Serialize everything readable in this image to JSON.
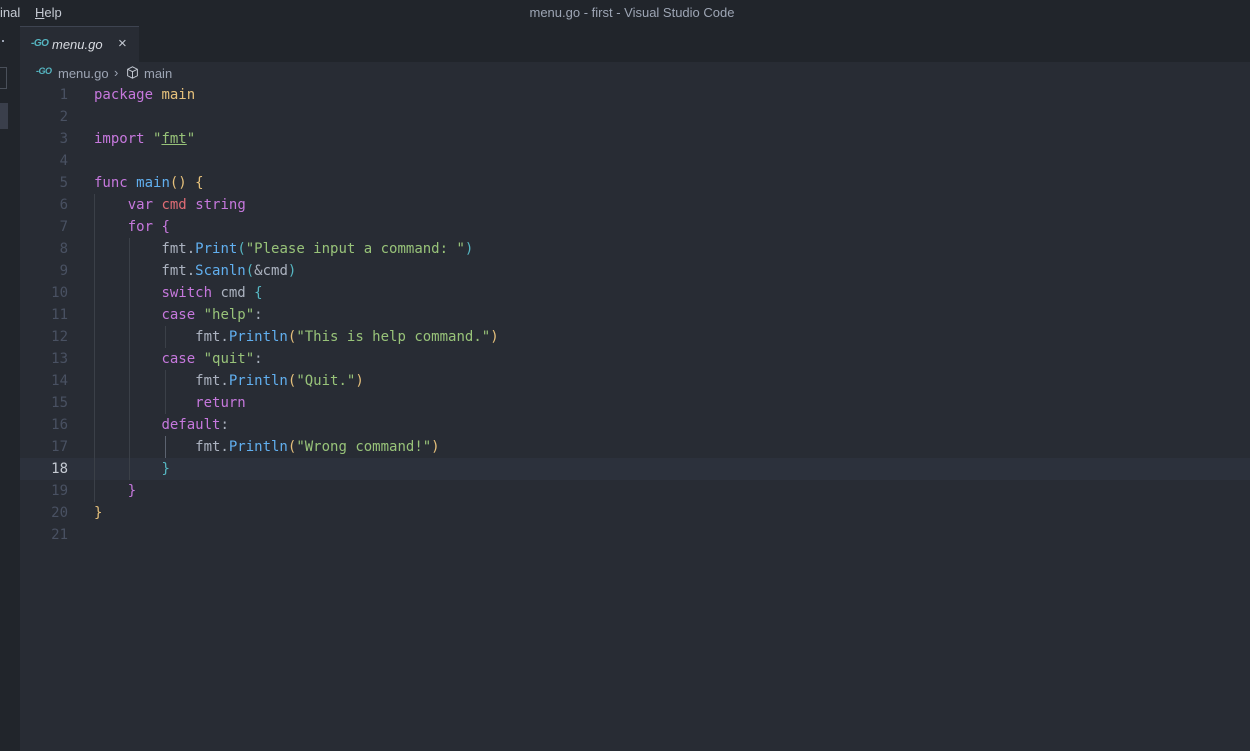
{
  "menu": {
    "terminal": "inal",
    "help_underline": "H",
    "help_rest": "elp"
  },
  "window_title": "menu.go - first - Visual Studio Code",
  "tab": {
    "label": "menu.go",
    "icon": "go-icon",
    "close": "×"
  },
  "breadcrumb": {
    "file": "menu.go",
    "symbol": "main"
  },
  "editor": {
    "current_line": 18,
    "lines": [
      {
        "n": "1",
        "tokens": [
          [
            "kw",
            "package"
          ],
          [
            "plain",
            " "
          ],
          [
            "pkg",
            "main"
          ]
        ]
      },
      {
        "n": "2",
        "tokens": []
      },
      {
        "n": "3",
        "tokens": [
          [
            "kw",
            "import"
          ],
          [
            "plain",
            " "
          ],
          [
            "str",
            "\""
          ],
          [
            "fmtu",
            "fmt"
          ],
          [
            "str",
            "\""
          ]
        ]
      },
      {
        "n": "4",
        "tokens": []
      },
      {
        "n": "5",
        "tokens": [
          [
            "kw",
            "func"
          ],
          [
            "plain",
            " "
          ],
          [
            "fn",
            "main"
          ],
          [
            "brace",
            "()"
          ],
          [
            "plain",
            " "
          ],
          [
            "brace",
            "{"
          ]
        ]
      },
      {
        "n": "6",
        "tokens": [
          [
            "plain",
            "    "
          ],
          [
            "kw",
            "var"
          ],
          [
            "plain",
            " "
          ],
          [
            "var",
            "cmd"
          ],
          [
            "plain",
            " "
          ],
          [
            "typ",
            "string"
          ]
        ]
      },
      {
        "n": "7",
        "tokens": [
          [
            "plain",
            "    "
          ],
          [
            "kw",
            "for"
          ],
          [
            "plain",
            " "
          ],
          [
            "brace2",
            "{"
          ]
        ]
      },
      {
        "n": "8",
        "tokens": [
          [
            "plain",
            "        fmt."
          ],
          [
            "fn",
            "Print"
          ],
          [
            "brace3",
            "("
          ],
          [
            "str",
            "\"Please input a command: \""
          ],
          [
            "brace3",
            ")"
          ]
        ]
      },
      {
        "n": "9",
        "tokens": [
          [
            "plain",
            "        fmt."
          ],
          [
            "fn",
            "Scanln"
          ],
          [
            "brace3",
            "("
          ],
          [
            "plain",
            "&cmd"
          ],
          [
            "brace3",
            ")"
          ]
        ]
      },
      {
        "n": "10",
        "tokens": [
          [
            "plain",
            "        "
          ],
          [
            "kw",
            "switch"
          ],
          [
            "plain",
            " cmd "
          ],
          [
            "brace3",
            "{"
          ]
        ]
      },
      {
        "n": "11",
        "tokens": [
          [
            "plain",
            "        "
          ],
          [
            "kw",
            "case"
          ],
          [
            "plain",
            " "
          ],
          [
            "str",
            "\"help\""
          ],
          [
            "plain",
            ":"
          ]
        ]
      },
      {
        "n": "12",
        "tokens": [
          [
            "plain",
            "            fmt."
          ],
          [
            "fn",
            "Println"
          ],
          [
            "brace",
            "("
          ],
          [
            "str",
            "\"This is help command.\""
          ],
          [
            "brace",
            ")"
          ]
        ]
      },
      {
        "n": "13",
        "tokens": [
          [
            "plain",
            "        "
          ],
          [
            "kw",
            "case"
          ],
          [
            "plain",
            " "
          ],
          [
            "str",
            "\"quit\""
          ],
          [
            "plain",
            ":"
          ]
        ]
      },
      {
        "n": "14",
        "tokens": [
          [
            "plain",
            "            fmt."
          ],
          [
            "fn",
            "Println"
          ],
          [
            "brace",
            "("
          ],
          [
            "str",
            "\"Quit.\""
          ],
          [
            "brace",
            ")"
          ]
        ]
      },
      {
        "n": "15",
        "tokens": [
          [
            "plain",
            "            "
          ],
          [
            "kw",
            "return"
          ]
        ]
      },
      {
        "n": "16",
        "tokens": [
          [
            "plain",
            "        "
          ],
          [
            "kw",
            "default"
          ],
          [
            "plain",
            ":"
          ]
        ]
      },
      {
        "n": "17",
        "tokens": [
          [
            "plain",
            "            fmt."
          ],
          [
            "fn",
            "Println"
          ],
          [
            "brace",
            "("
          ],
          [
            "str",
            "\"Wrong command!\""
          ],
          [
            "brace",
            ")"
          ]
        ]
      },
      {
        "n": "18",
        "tokens": [
          [
            "plain",
            "        "
          ],
          [
            "brace3",
            "}"
          ]
        ]
      },
      {
        "n": "19",
        "tokens": [
          [
            "plain",
            "    "
          ],
          [
            "brace2",
            "}"
          ]
        ]
      },
      {
        "n": "20",
        "tokens": [
          [
            "brace",
            "}"
          ]
        ]
      },
      {
        "n": "21",
        "tokens": []
      }
    ]
  }
}
